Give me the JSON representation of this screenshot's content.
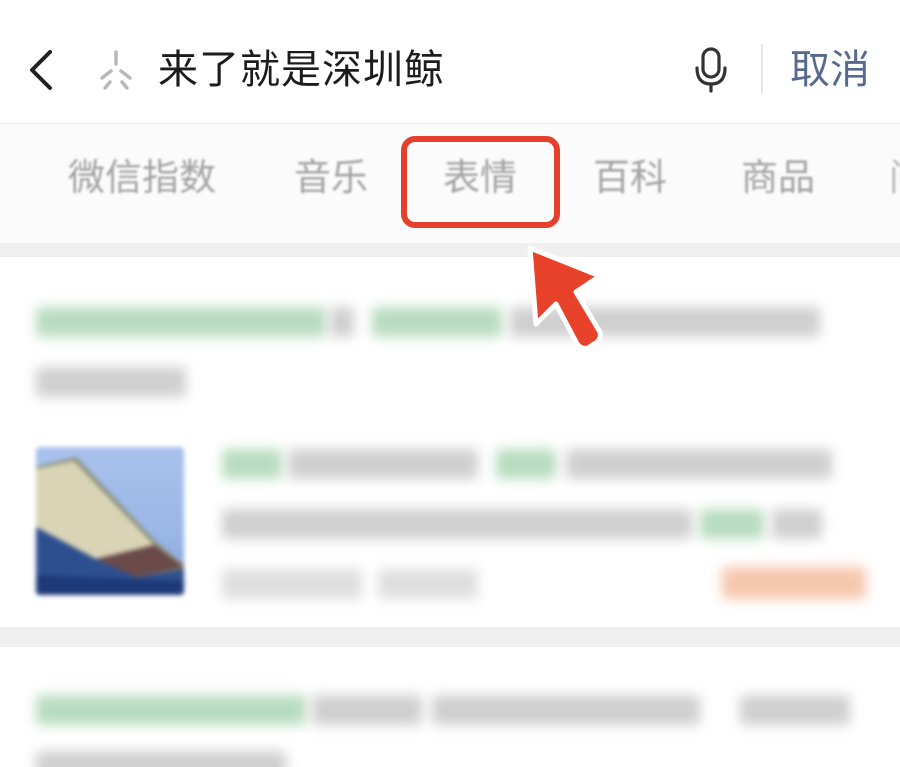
{
  "search": {
    "query": "来了就是深圳鲸",
    "cancel_label": "取消"
  },
  "tabs": [
    {
      "label": "微信指数"
    },
    {
      "label": "音乐"
    },
    {
      "label": "表情"
    },
    {
      "label": "百科"
    },
    {
      "label": "商品"
    },
    {
      "label": "问"
    }
  ],
  "colors": {
    "accent_link": "#56698f",
    "highlight": "#e5402b",
    "tab_text": "#a3a3a3"
  },
  "icons": {
    "back": "back-arrow-icon",
    "sparkle": "sparkle-icon",
    "mic": "microphone-icon",
    "pointer": "pointer-arrow-icon"
  }
}
